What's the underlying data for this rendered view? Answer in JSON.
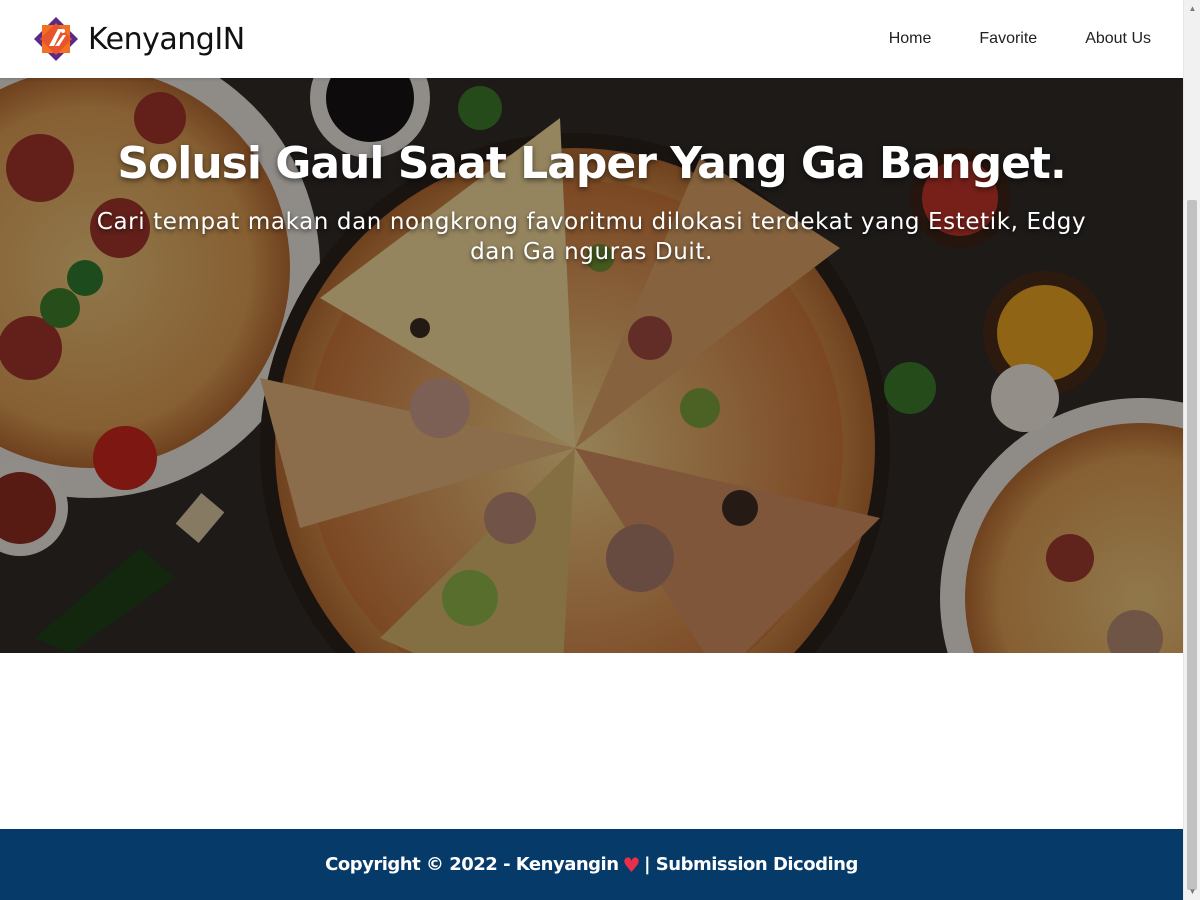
{
  "brand": {
    "name": "KenyangIN",
    "logo_icon": "kenyangin-logo-icon"
  },
  "nav": {
    "items": [
      {
        "label": "Home"
      },
      {
        "label": "Favorite"
      },
      {
        "label": "About Us"
      }
    ]
  },
  "hero": {
    "title": "Solusi Gaul Saat Laper Yang Ga Banget.",
    "subtitle": "Cari tempat makan dan nongkrong favoritmu dilokasi terdekat yang Estetik, Edgy dan Ga nguras Duit."
  },
  "footer": {
    "copyright": "Copyright © 2022 - Kenyangin",
    "heart_icon": "heart-icon",
    "suffix": "| Submission Dicoding"
  },
  "colors": {
    "footer_bg": "#063a69",
    "heart": "#e8304a",
    "logo_purple": "#5b2a86",
    "logo_orange": "#f36f21"
  }
}
